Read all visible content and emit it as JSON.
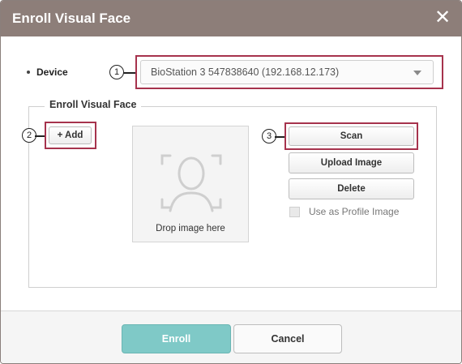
{
  "dialog": {
    "title": "Enroll Visual Face",
    "close_glyph": "✕"
  },
  "device": {
    "label": "Device",
    "selected": "BioStation 3 547838640 (192.168.12.173)"
  },
  "enroll_section": {
    "legend": "Enroll Visual Face",
    "add_label": "+ Add",
    "drop_hint": "Drop image here",
    "scan_label": "Scan",
    "upload_label": "Upload Image",
    "delete_label": "Delete",
    "profile_checkbox_label": "Use as Profile Image",
    "profile_checked": false
  },
  "callouts": {
    "one": "1",
    "two": "2",
    "three": "3"
  },
  "footer": {
    "enroll_label": "Enroll",
    "cancel_label": "Cancel"
  },
  "colors": {
    "titlebar": "#8d7e79",
    "callout_border": "#a6334d",
    "enroll_button": "#7fc9c7"
  }
}
